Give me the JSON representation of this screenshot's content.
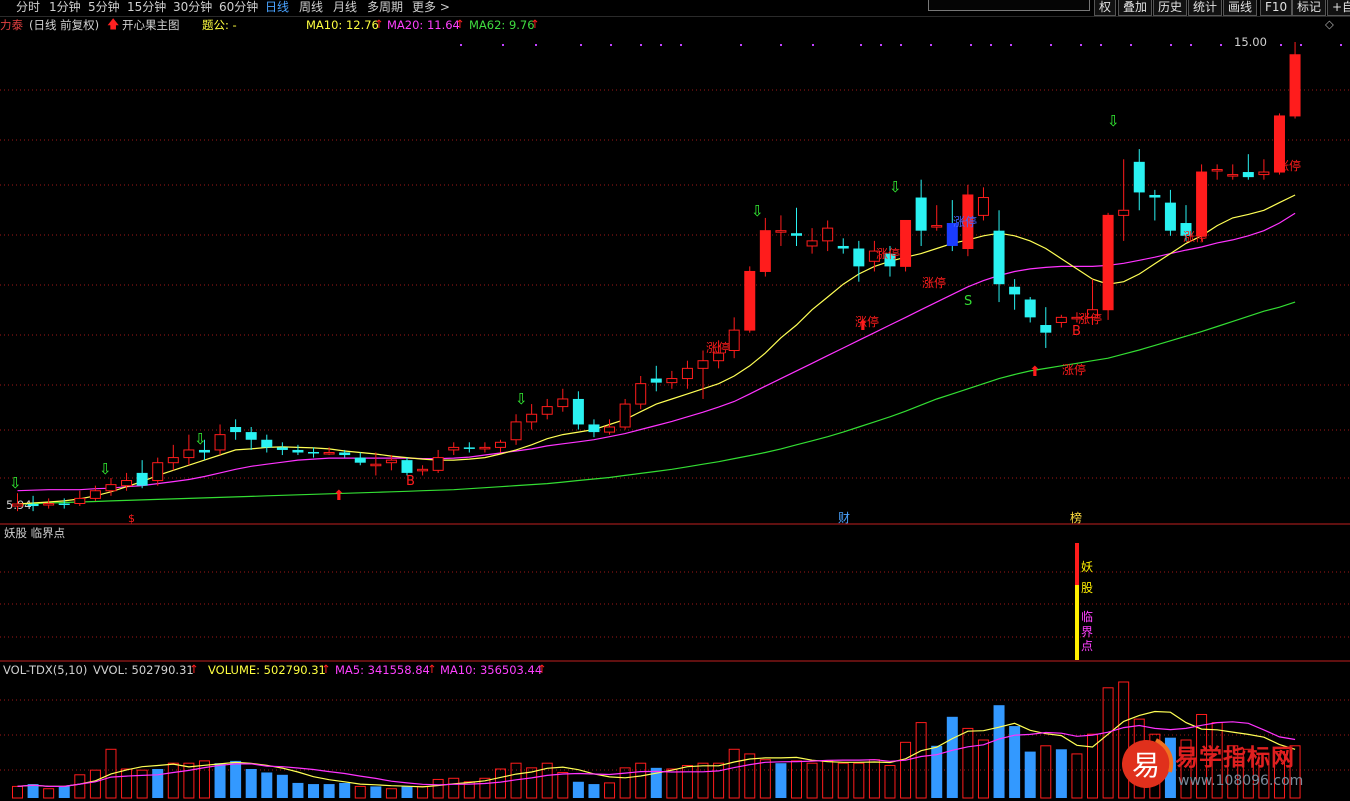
{
  "toolbar": {
    "periods": [
      "分时",
      "1分钟",
      "5分钟",
      "15分钟",
      "30分钟",
      "60分钟",
      "日线",
      "周线",
      "月线",
      "多周期",
      "更多 >"
    ],
    "active_period": "日线",
    "right_buttons": [
      "权",
      "叠加",
      "历史",
      "统计",
      "画线",
      "F10",
      "标记",
      "+自"
    ]
  },
  "main_panel": {
    "stock_name": "力泰",
    "period_label": "(日线 前复权)",
    "indicator_name": "开心果主图",
    "extra_label": "题公: -",
    "ma10_label": "MA10: 12.76",
    "ma20_label": "MA20: 11.64",
    "ma62_label": "MA62: 9.76",
    "price_high_label": "15.00",
    "price_low_label": "5.94",
    "markers": {
      "limit_up": "涨停",
      "buy": "B",
      "sell": "S",
      "dollar": "$",
      "cai": "财",
      "bang": "榜"
    }
  },
  "indicator_panel": {
    "title": "妖股 临界点",
    "chars_1": [
      "妖",
      "股"
    ],
    "chars_2": [
      "临",
      "界",
      "点"
    ]
  },
  "volume_panel": {
    "title": "VOL-TDX(5,10)",
    "vvol_label": "VVOL: 502790.31",
    "volume_label": "VOLUME: 502790.31",
    "ma5_label": "MA5: 341558.84",
    "ma10_label": "MA10: 356503.44"
  },
  "watermark": {
    "logo_char": "易",
    "title": "易学指标网",
    "url": "www.108096.com"
  },
  "colors": {
    "up": "#ff1c1c",
    "down": "#2af2f2",
    "ma10": "#ffff55",
    "ma20": "#ff33ff",
    "ma62": "#33dd33",
    "grid": "#a01818",
    "vol_down": "#3399ff"
  },
  "chart_data": {
    "type": "candlestick",
    "ylim": [
      5.94,
      15.0
    ],
    "candles": [
      [
        5.9,
        5.94,
        6.15,
        5.8
      ],
      [
        5.94,
        5.9,
        6.1,
        5.8
      ],
      [
        5.92,
        5.95,
        6.05,
        5.85
      ],
      [
        5.95,
        5.93,
        6.05,
        5.85
      ],
      [
        5.95,
        6.05,
        6.2,
        5.9
      ],
      [
        6.05,
        6.2,
        6.3,
        6.0
      ],
      [
        6.2,
        6.32,
        6.45,
        6.1
      ],
      [
        6.3,
        6.4,
        6.55,
        6.2
      ],
      [
        6.55,
        6.3,
        6.8,
        6.25
      ],
      [
        6.4,
        6.75,
        6.85,
        6.3
      ],
      [
        6.75,
        6.85,
        7.1,
        6.6
      ],
      [
        6.85,
        7.0,
        7.3,
        6.7
      ],
      [
        7.0,
        6.95,
        7.2,
        6.8
      ],
      [
        7.0,
        7.3,
        7.5,
        6.9
      ],
      [
        7.45,
        7.35,
        7.6,
        7.2
      ],
      [
        7.35,
        7.2,
        7.45,
        7.0
      ],
      [
        7.2,
        7.05,
        7.3,
        6.95
      ],
      [
        7.05,
        7.0,
        7.15,
        6.9
      ],
      [
        7.0,
        6.95,
        7.1,
        6.9
      ],
      [
        6.96,
        6.93,
        7.05,
        6.85
      ],
      [
        6.95,
        6.95,
        7.05,
        6.9
      ],
      [
        6.95,
        6.9,
        7.0,
        6.85
      ],
      [
        6.85,
        6.75,
        6.95,
        6.7
      ],
      [
        6.7,
        6.72,
        6.95,
        6.5
      ],
      [
        6.75,
        6.8,
        6.9,
        6.6
      ],
      [
        6.8,
        6.55,
        6.85,
        6.5
      ],
      [
        6.6,
        6.62,
        6.7,
        6.5
      ],
      [
        6.6,
        6.85,
        7.0,
        6.55
      ],
      [
        7.0,
        7.05,
        7.15,
        6.9
      ],
      [
        7.05,
        7.02,
        7.15,
        6.95
      ],
      [
        7.05,
        7.05,
        7.15,
        6.95
      ],
      [
        7.05,
        7.15,
        7.2,
        6.95
      ],
      [
        7.2,
        7.55,
        7.7,
        7.1
      ],
      [
        7.55,
        7.7,
        7.9,
        7.4
      ],
      [
        7.7,
        7.85,
        8.0,
        7.6
      ],
      [
        7.85,
        8.0,
        8.2,
        7.75
      ],
      [
        8.0,
        7.5,
        8.15,
        7.4
      ],
      [
        7.5,
        7.35,
        7.6,
        7.25
      ],
      [
        7.35,
        7.45,
        7.6,
        7.3
      ],
      [
        7.45,
        7.9,
        8.0,
        7.4
      ],
      [
        7.9,
        8.3,
        8.45,
        7.8
      ],
      [
        8.4,
        8.32,
        8.65,
        8.15
      ],
      [
        8.32,
        8.4,
        8.55,
        8.2
      ],
      [
        8.4,
        8.6,
        8.75,
        8.2
      ],
      [
        8.6,
        8.75,
        8.95,
        8.0
      ],
      [
        8.75,
        8.9,
        9.15,
        8.6
      ],
      [
        8.95,
        9.35,
        9.6,
        8.8
      ],
      [
        9.35,
        10.5,
        10.6,
        9.3
      ],
      [
        10.5,
        11.3,
        11.55,
        10.4
      ],
      [
        11.3,
        11.3,
        11.6,
        11.0
      ],
      [
        11.25,
        11.2,
        11.75,
        11.0
      ],
      [
        11.0,
        11.1,
        11.35,
        10.85
      ],
      [
        11.1,
        11.35,
        11.5,
        10.9
      ],
      [
        11.0,
        10.95,
        11.15,
        10.85
      ],
      [
        10.95,
        10.6,
        11.1,
        10.3
      ],
      [
        10.7,
        10.9,
        11.1,
        10.5
      ],
      [
        10.85,
        10.6,
        11.0,
        10.4
      ],
      [
        10.6,
        11.5,
        11.5,
        10.5
      ],
      [
        11.95,
        11.3,
        12.3,
        11.0
      ],
      [
        11.4,
        11.4,
        11.8,
        11.3
      ],
      [
        11.45,
        11.0,
        11.9,
        10.9
      ],
      [
        10.95,
        12.0,
        12.2,
        10.8
      ],
      [
        11.6,
        11.95,
        12.15,
        11.5
      ],
      [
        11.3,
        10.25,
        11.7,
        9.9
      ],
      [
        10.2,
        10.05,
        10.35,
        9.75
      ],
      [
        9.95,
        9.6,
        10.0,
        9.5
      ],
      [
        9.45,
        9.3,
        9.8,
        9.0
      ],
      [
        9.5,
        9.6,
        9.65,
        9.4
      ],
      [
        9.6,
        9.6,
        9.7,
        9.5
      ],
      [
        9.6,
        9.75,
        10.35,
        9.45
      ],
      [
        9.75,
        11.6,
        11.65,
        9.55
      ],
      [
        11.6,
        11.7,
        12.7,
        11.1
      ],
      [
        12.65,
        12.05,
        12.9,
        11.7
      ],
      [
        12.0,
        11.95,
        12.1,
        11.5
      ],
      [
        11.85,
        11.3,
        12.1,
        11.2
      ],
      [
        11.45,
        11.2,
        11.8,
        11.1
      ],
      [
        11.2,
        12.45,
        12.6,
        11.1
      ],
      [
        12.5,
        12.5,
        12.6,
        12.3
      ],
      [
        12.4,
        12.4,
        12.6,
        12.3
      ],
      [
        12.45,
        12.35,
        12.8,
        12.3
      ],
      [
        12.4,
        12.45,
        12.7,
        12.3
      ],
      [
        12.45,
        13.55,
        13.6,
        12.4
      ],
      [
        13.55,
        14.75,
        15.0,
        13.5
      ]
    ],
    "volumes": [
      [
        0.1,
        "up"
      ],
      [
        0.12,
        "down"
      ],
      [
        0.08,
        "up"
      ],
      [
        0.1,
        "down"
      ],
      [
        0.2,
        "up"
      ],
      [
        0.24,
        "up"
      ],
      [
        0.42,
        "up"
      ],
      [
        0.25,
        "up"
      ],
      [
        0.24,
        "up"
      ],
      [
        0.25,
        "down"
      ],
      [
        0.3,
        "up"
      ],
      [
        0.3,
        "up"
      ],
      [
        0.32,
        "up"
      ],
      [
        0.3,
        "down"
      ],
      [
        0.32,
        "down"
      ],
      [
        0.25,
        "down"
      ],
      [
        0.22,
        "down"
      ],
      [
        0.2,
        "down"
      ],
      [
        0.13,
        "down"
      ],
      [
        0.12,
        "down"
      ],
      [
        0.12,
        "down"
      ],
      [
        0.13,
        "down"
      ],
      [
        0.1,
        "up"
      ],
      [
        0.1,
        "down"
      ],
      [
        0.08,
        "up"
      ],
      [
        0.1,
        "down"
      ],
      [
        0.1,
        "up"
      ],
      [
        0.16,
        "up"
      ],
      [
        0.17,
        "up"
      ],
      [
        0.14,
        "up"
      ],
      [
        0.17,
        "up"
      ],
      [
        0.25,
        "up"
      ],
      [
        0.3,
        "up"
      ],
      [
        0.26,
        "up"
      ],
      [
        0.3,
        "up"
      ],
      [
        0.22,
        "up"
      ],
      [
        0.14,
        "down"
      ],
      [
        0.12,
        "down"
      ],
      [
        0.13,
        "up"
      ],
      [
        0.26,
        "up"
      ],
      [
        0.3,
        "up"
      ],
      [
        0.26,
        "down"
      ],
      [
        0.25,
        "up"
      ],
      [
        0.28,
        "up"
      ],
      [
        0.3,
        "up"
      ],
      [
        0.3,
        "up"
      ],
      [
        0.42,
        "up"
      ],
      [
        0.38,
        "up"
      ],
      [
        0.33,
        "up"
      ],
      [
        0.3,
        "down"
      ],
      [
        0.32,
        "up"
      ],
      [
        0.3,
        "up"
      ],
      [
        0.32,
        "up"
      ],
      [
        0.3,
        "up"
      ],
      [
        0.3,
        "up"
      ],
      [
        0.33,
        "up"
      ],
      [
        0.28,
        "up"
      ],
      [
        0.48,
        "up"
      ],
      [
        0.65,
        "up"
      ],
      [
        0.45,
        "down"
      ],
      [
        0.7,
        "down"
      ],
      [
        0.6,
        "up"
      ],
      [
        0.5,
        "up"
      ],
      [
        0.8,
        "down"
      ],
      [
        0.62,
        "down"
      ],
      [
        0.4,
        "down"
      ],
      [
        0.45,
        "up"
      ],
      [
        0.42,
        "down"
      ],
      [
        0.38,
        "up"
      ],
      [
        0.55,
        "up"
      ],
      [
        0.95,
        "up"
      ],
      [
        1.0,
        "up"
      ],
      [
        0.68,
        "up"
      ],
      [
        0.55,
        "up"
      ],
      [
        0.52,
        "down"
      ],
      [
        0.5,
        "up"
      ],
      [
        0.72,
        "up"
      ],
      [
        0.65,
        "up"
      ],
      [
        0.45,
        "up"
      ],
      [
        0.42,
        "up"
      ],
      [
        0.38,
        "up"
      ],
      [
        0.4,
        "up"
      ],
      [
        0.45,
        "up"
      ]
    ],
    "ma10": [
      5.94,
      5.96,
      5.98,
      6.0,
      6.04,
      6.1,
      6.18,
      6.28,
      6.38,
      6.5,
      6.6,
      6.7,
      6.8,
      6.9,
      7.0,
      7.02,
      7.05,
      7.06,
      7.05,
      7.04,
      7.02,
      6.98,
      6.95,
      6.92,
      6.88,
      6.85,
      6.82,
      6.8,
      6.8,
      6.82,
      6.85,
      6.92,
      7.0,
      7.1,
      7.22,
      7.3,
      7.35,
      7.4,
      7.5,
      7.6,
      7.75,
      7.9,
      8.0,
      8.1,
      8.2,
      8.3,
      8.45,
      8.65,
      8.9,
      9.2,
      9.45,
      9.75,
      10.0,
      10.25,
      10.45,
      10.6,
      10.7,
      10.78,
      10.85,
      10.95,
      11.05,
      11.12,
      11.2,
      11.25,
      11.2,
      11.1,
      10.95,
      10.75,
      10.55,
      10.35,
      10.25,
      10.3,
      10.45,
      10.65,
      10.85,
      11.05,
      11.2,
      11.4,
      11.55,
      11.62,
      11.7,
      11.85,
      12.0
    ],
    "ma20": [
      6.2,
      6.21,
      6.22,
      6.22,
      6.22,
      6.24,
      6.25,
      6.28,
      6.3,
      6.34,
      6.38,
      6.42,
      6.48,
      6.55,
      6.62,
      6.68,
      6.72,
      6.76,
      6.8,
      6.82,
      6.84,
      6.84,
      6.84,
      6.84,
      6.84,
      6.84,
      6.83,
      6.83,
      6.84,
      6.86,
      6.9,
      6.94,
      6.98,
      7.02,
      7.08,
      7.12,
      7.16,
      7.2,
      7.26,
      7.32,
      7.4,
      7.48,
      7.56,
      7.65,
      7.74,
      7.84,
      7.95,
      8.1,
      8.25,
      8.4,
      8.55,
      8.7,
      8.85,
      9.0,
      9.15,
      9.3,
      9.45,
      9.6,
      9.75,
      9.9,
      10.05,
      10.2,
      10.32,
      10.42,
      10.5,
      10.55,
      10.58,
      10.6,
      10.6,
      10.6,
      10.62,
      10.66,
      10.72,
      10.78,
      10.85,
      10.92,
      10.98,
      11.06,
      11.12,
      11.2,
      11.3,
      11.45,
      11.64
    ],
    "ma62": [
      5.94,
      5.95,
      5.96,
      5.97,
      5.98,
      5.99,
      6.0,
      6.01,
      6.02,
      6.03,
      6.04,
      6.05,
      6.06,
      6.07,
      6.08,
      6.09,
      6.1,
      6.11,
      6.12,
      6.13,
      6.14,
      6.15,
      6.16,
      6.17,
      6.18,
      6.19,
      6.2,
      6.21,
      6.22,
      6.24,
      6.26,
      6.28,
      6.3,
      6.32,
      6.34,
      6.37,
      6.4,
      6.43,
      6.46,
      6.5,
      6.54,
      6.58,
      6.62,
      6.67,
      6.72,
      6.77,
      6.83,
      6.89,
      6.95,
      7.02,
      7.1,
      7.18,
      7.26,
      7.35,
      7.45,
      7.55,
      7.65,
      7.76,
      7.88,
      8.0,
      8.1,
      8.2,
      8.3,
      8.4,
      8.48,
      8.55,
      8.6,
      8.65,
      8.7,
      8.75,
      8.8,
      8.88,
      8.96,
      9.05,
      9.14,
      9.23,
      9.32,
      9.42,
      9.52,
      9.62,
      9.72,
      9.8,
      9.9
    ]
  }
}
